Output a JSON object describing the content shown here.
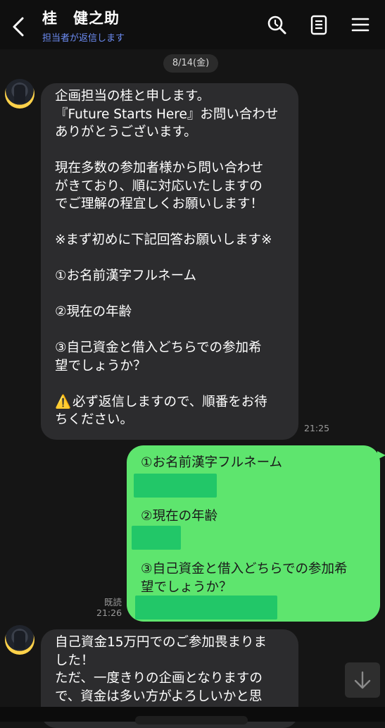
{
  "header": {
    "title": "桂　健之助",
    "subtitle": "担当者が返信します"
  },
  "date_label": "8/14(金)",
  "messages": [
    {
      "from": "them",
      "time": "21:25",
      "lines": [
        "企画担当の桂と申します。",
        "『Future Starts Here』お問い合わせ",
        "ありがとうございます。",
        "",
        "現在多数の参加者様から問い合わせ",
        "がきており、順に対応いたしますの",
        "でご理解の程宜しくお願いします！",
        "",
        "※まず初めに下記回答お願いします※",
        "",
        "①お名前漢字フルネーム",
        "",
        "②現在の年齢",
        "",
        "③自己資金と借入どちらでの参加希",
        "望でしょうか？",
        "",
        "必ず返信しますので、順番をお待",
        "ちください。"
      ],
      "warning_icon": "⚠️"
    },
    {
      "from": "me",
      "read_label": "既読",
      "time": "21:26",
      "lines": [
        "①お名前漢字フルネーム",
        "②現在の年齢",
        "③自己資金と借入どちらでの参加希",
        "望でしょうか？"
      ]
    },
    {
      "from": "them",
      "lines": [
        "自己資金15万円でのご参加畏まりま",
        "した！",
        "ただ、一度きりの企画となりますの",
        "で、資金は多い方がよろしいかと思"
      ]
    }
  ],
  "icons": {
    "back": "chevron-left-icon",
    "search": "search-icon",
    "notes": "note-icon",
    "menu": "menu-icon",
    "scroll": "arrow-down-icon"
  },
  "colors": {
    "background": "#151515",
    "incoming_bubble": "#2c2c2e",
    "outgoing_bubble": "#5ee56e",
    "subtitle": "#6d8df5"
  }
}
